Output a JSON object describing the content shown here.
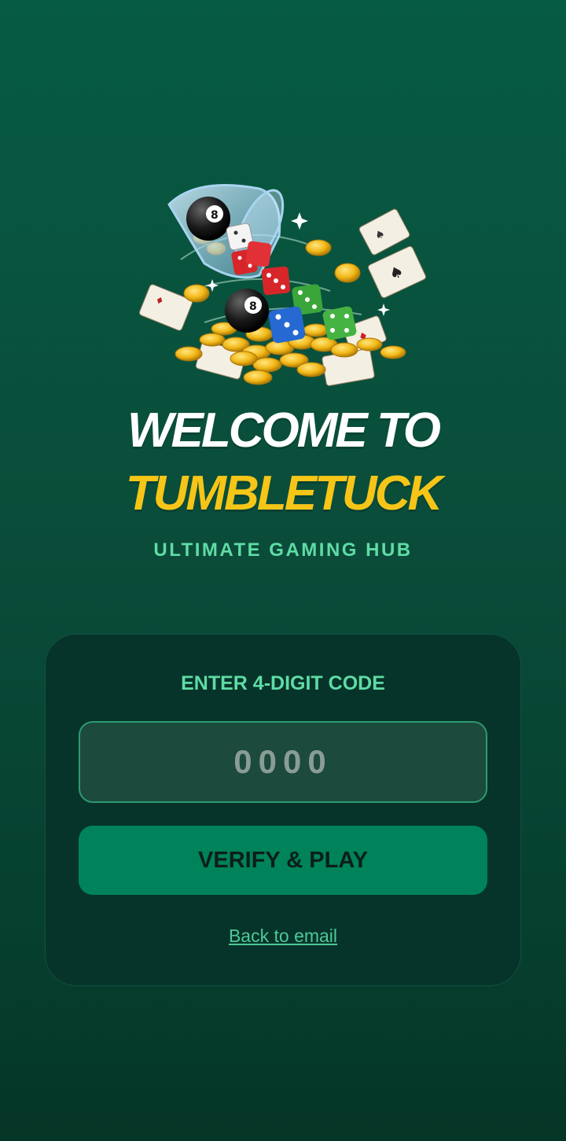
{
  "hero": {
    "illustration": "dice-cards-coins-8ball-illustration",
    "colors": {
      "coin": "#f2b817",
      "die_red": "#d7262a",
      "die_green": "#3aa63a",
      "die_blue": "#2669d2",
      "card": "#f4efe3"
    }
  },
  "welcome": {
    "line1": "WELCOME TO",
    "line2": "TUMBLETUCK",
    "tagline": "ULTIMATE GAMING HUB"
  },
  "verify_card": {
    "label": "ENTER 4-DIGIT CODE",
    "code_placeholder": "0000",
    "code_value": "",
    "button_label": "VERIFY & PLAY",
    "back_link": "Back to email"
  },
  "colors": {
    "background": "#0a4d3a",
    "accent_green": "#5fdca5",
    "brand_yellow": "#f5c518",
    "button": "#00825b",
    "card_bg": "#06342a"
  }
}
